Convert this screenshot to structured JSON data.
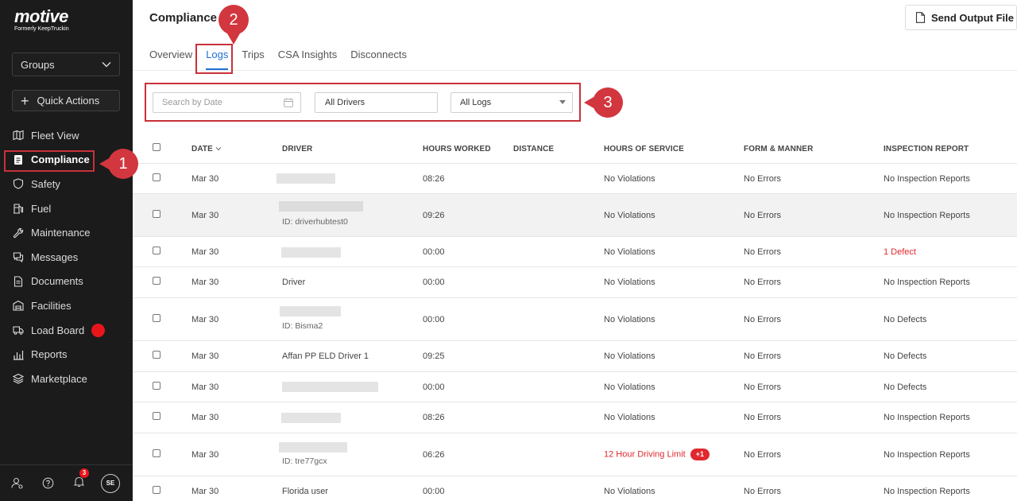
{
  "brand": {
    "name": "motive",
    "tagline": "Formerly KeepTruckin"
  },
  "sidebar": {
    "groups_label": "Groups",
    "quick_actions_label": "Quick Actions",
    "items": [
      {
        "label": "Fleet View",
        "icon": "map-icon"
      },
      {
        "label": "Compliance",
        "icon": "clipboard-icon",
        "active": true
      },
      {
        "label": "Safety",
        "icon": "shield-icon"
      },
      {
        "label": "Fuel",
        "icon": "fuel-pump-icon"
      },
      {
        "label": "Maintenance",
        "icon": "wrench-icon"
      },
      {
        "label": "Messages",
        "icon": "chat-icon"
      },
      {
        "label": "Documents",
        "icon": "document-icon"
      },
      {
        "label": "Facilities",
        "icon": "building-icon"
      },
      {
        "label": "Load Board",
        "icon": "truck-icon"
      },
      {
        "label": "Reports",
        "icon": "bar-chart-icon"
      },
      {
        "label": "Marketplace",
        "icon": "layers-icon"
      }
    ],
    "bottom": {
      "notifications_count": "3",
      "avatar_initials": "SE"
    }
  },
  "header": {
    "title": "Compliance",
    "send_button": "Send Output File"
  },
  "tabs": [
    "Overview",
    "Logs",
    "Trips",
    "CSA Insights",
    "Disconnects"
  ],
  "filters": {
    "date_placeholder": "Search by Date",
    "drivers_value": "All Drivers",
    "logs_value": "All Logs"
  },
  "table": {
    "columns": [
      "DATE",
      "DRIVER",
      "HOURS WORKED",
      "DISTANCE",
      "HOURS OF SERVICE",
      "FORM & MANNER",
      "INSPECTION REPORT"
    ],
    "rows": [
      {
        "date": "Mar 30",
        "driver": "",
        "driver_id": "",
        "hours": "08:26",
        "hos": "No Violations",
        "hos_extra": "",
        "form": "No Errors",
        "inspection": "No Inspection Reports"
      },
      {
        "date": "Mar 30",
        "driver": "",
        "driver_id": "ID: driverhubtest0",
        "hours": "09:26",
        "hos": "No Violations",
        "hos_extra": "",
        "form": "No Errors",
        "inspection": "No Inspection Reports"
      },
      {
        "date": "Mar 30",
        "driver": "",
        "driver_id": "",
        "hours": "00:00",
        "hos": "No Violations",
        "hos_extra": "",
        "form": "No Errors",
        "inspection": "1 Defect"
      },
      {
        "date": "Mar 30",
        "driver": "Driver",
        "driver_id": "",
        "hours": "00:00",
        "hos": "No Violations",
        "hos_extra": "",
        "form": "No Errors",
        "inspection": "No Inspection Reports"
      },
      {
        "date": "Mar 30",
        "driver": "",
        "driver_id": "ID: Bisma2",
        "hours": "00:00",
        "hos": "No Violations",
        "hos_extra": "",
        "form": "No Errors",
        "inspection": "No Defects"
      },
      {
        "date": "Mar 30",
        "driver": "Affan PP ELD Driver 1",
        "driver_id": "",
        "hours": "09:25",
        "hos": "No Violations",
        "hos_extra": "",
        "form": "No Errors",
        "inspection": "No Defects"
      },
      {
        "date": "Mar 30",
        "driver": "",
        "driver_id": "",
        "hours": "00:00",
        "hos": "No Violations",
        "hos_extra": "",
        "form": "No Errors",
        "inspection": "No Defects"
      },
      {
        "date": "Mar 30",
        "driver": "",
        "driver_id": "",
        "hours": "08:26",
        "hos": "No Violations",
        "hos_extra": "",
        "form": "No Errors",
        "inspection": "No Inspection Reports"
      },
      {
        "date": "Mar 30",
        "driver": "",
        "driver_id": "ID: tre77gcx",
        "hours": "06:26",
        "hos": "12 Hour Driving Limit",
        "hos_extra": "+1",
        "form": "No Errors",
        "inspection": "No Inspection Reports"
      },
      {
        "date": "Mar 30",
        "driver": "Florida user",
        "driver_id": "",
        "hours": "00:00",
        "hos": "No Violations",
        "hos_extra": "",
        "form": "No Errors",
        "inspection": "No Inspection Reports"
      }
    ]
  },
  "annotations": [
    "1",
    "2",
    "3"
  ],
  "colors": {
    "sidebar_bg": "#1b1b1b",
    "accent": "#1f6fd6",
    "alert": "#e0282e",
    "annotation": "#c8313a"
  }
}
